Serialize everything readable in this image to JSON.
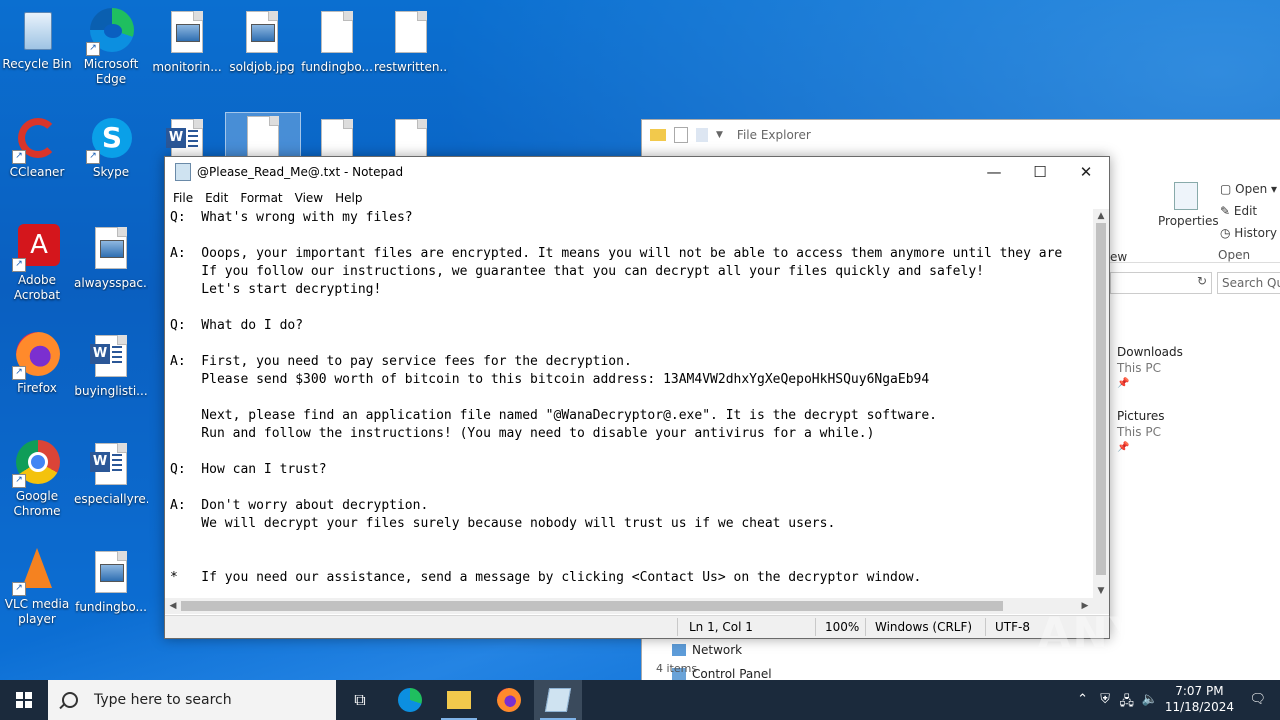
{
  "desktop": {
    "icons": [
      {
        "label": "Recycle Bin"
      },
      {
        "label": "Microsoft Edge"
      },
      {
        "label": "monitorin..."
      },
      {
        "label": "soldjob.jpg"
      },
      {
        "label": "fundingbo..."
      },
      {
        "label": "restwritten...."
      },
      {
        "label": "CCleaner"
      },
      {
        "label": "Skype"
      },
      {
        "label": "Adobe Acrobat"
      },
      {
        "label": "alwaysspac..."
      },
      {
        "label": "Firefox"
      },
      {
        "label": "buyinglisti..."
      },
      {
        "label": "Google Chrome"
      },
      {
        "label": "especiallyre..."
      },
      {
        "label": "VLC media player"
      },
      {
        "label": "fundingbo..."
      }
    ]
  },
  "explorer": {
    "title": "File Explorer",
    "ribbon": {
      "open": "Open",
      "edit": "Edit",
      "history": "History",
      "properties": "Properties",
      "open_group": "Open",
      "view_cut": "ew"
    },
    "search_placeholder": "Search Quic",
    "quick_access": [
      {
        "name": "Downloads",
        "sub": "This PC"
      },
      {
        "name": "Pictures",
        "sub": "This PC"
      }
    ],
    "nav": [
      {
        "label": "Network"
      },
      {
        "label": "Control Panel"
      }
    ],
    "status": "4 items"
  },
  "notepad": {
    "title": "@Please_Read_Me@.txt - Notepad",
    "menu": [
      "File",
      "Edit",
      "Format",
      "View",
      "Help"
    ],
    "lines": [
      "Q:  What's wrong with my files?",
      "",
      "A:  Ooops, your important files are encrypted. It means you will not be able to access them anymore until they are",
      "    If you follow our instructions, we guarantee that you can decrypt all your files quickly and safely!",
      "    Let's start decrypting!",
      "",
      "Q:  What do I do?",
      "",
      "A:  First, you need to pay service fees for the decryption.",
      "    Please send $300 worth of bitcoin to this bitcoin address: 13AM4VW2dhxYgXeQepoHkHSQuy6NgaEb94",
      "",
      "    Next, please find an application file named \"@WanaDecryptor@.exe\". It is the decrypt software.",
      "    Run and follow the instructions! (You may need to disable your antivirus for a while.)",
      "",
      "Q:  How can I trust?",
      "",
      "A:  Don't worry about decryption.",
      "    We will decrypt your files surely because nobody will trust us if we cheat users.",
      "",
      "",
      "*   If you need our assistance, send a message by clicking <Contact Us> on the decryptor window."
    ],
    "status": {
      "position": "Ln 1, Col 1",
      "zoom": "100%",
      "line_ending": "Windows (CRLF)",
      "encoding": "UTF-8"
    }
  },
  "taskbar": {
    "search_placeholder": "Type here to search",
    "time": "7:07 PM",
    "date": "11/18/2024"
  },
  "watermark": "ANY RUN"
}
